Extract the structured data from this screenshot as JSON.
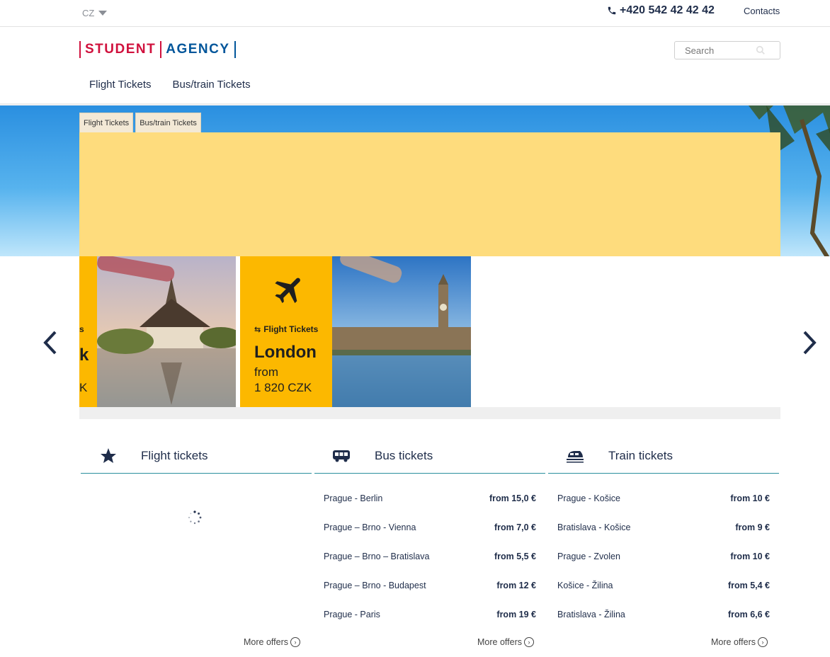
{
  "topbar": {
    "language": "CZ",
    "phone": "+420 542 42 42 42",
    "contacts": "Contacts"
  },
  "header": {
    "logo_left": "STUDENT",
    "logo_right": "AGENCY",
    "search_placeholder": "Search",
    "nav": [
      "Flight Tickets",
      "Bus/train Tickets"
    ]
  },
  "hero": {
    "tabs": [
      "Flight Tickets",
      "Bus/train Tickets"
    ]
  },
  "carousel": {
    "partial_card": {
      "label": "s",
      "city": "k",
      "price": "K"
    },
    "card": {
      "label": "Flight Tickets",
      "city": "London",
      "from": "from",
      "price": "1 820 CZK"
    }
  },
  "columns": {
    "flight": {
      "title": "Flight tickets",
      "more": "More offers"
    },
    "bus": {
      "title": "Bus tickets",
      "more": "More offers",
      "rows": [
        {
          "route": "Prague - Berlin",
          "price": "from 15,0 €"
        },
        {
          "route": "Prague – Brno - Vienna",
          "price": "from 7,0 €"
        },
        {
          "route": "Prague – Brno – Bratislava",
          "price": "from 5,5 €"
        },
        {
          "route": "Prague – Brno - Budapest",
          "price": "from 12 €"
        },
        {
          "route": "Prague - Paris",
          "price": "from 19 €"
        }
      ]
    },
    "train": {
      "title": "Train tickets",
      "more": "More offers",
      "rows": [
        {
          "route": "Prague - Košice",
          "price": "from 10 €"
        },
        {
          "route": "Bratislava - Košice",
          "price": "from 9 €"
        },
        {
          "route": "Prague - Zvolen",
          "price": "from 10 €"
        },
        {
          "route": "Košice - Žilina",
          "price": "from 5,4 €"
        },
        {
          "route": "Bratislava - Žilina",
          "price": "from 6,6 €"
        }
      ]
    }
  },
  "colors": {
    "brand_red": "#d0113d",
    "brand_blue": "#00559a",
    "accent_yellow": "#fcb800",
    "banner_yellow": "#fedc7d",
    "divider_teal": "#2a8f9e"
  }
}
